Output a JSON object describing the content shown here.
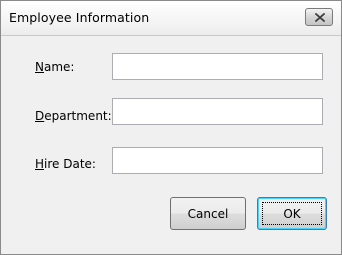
{
  "window": {
    "title": "Employee Information",
    "close_icon": "close-icon"
  },
  "form": {
    "name": {
      "label_mnemonic": "N",
      "label_rest": "ame:",
      "value": ""
    },
    "department": {
      "label_mnemonic": "D",
      "label_rest": "epartment:",
      "value": ""
    },
    "hire_date": {
      "label_mnemonic": "H",
      "label_rest": "ire Date:",
      "value": ""
    }
  },
  "buttons": {
    "cancel_label": "Cancel",
    "ok_label": "OK"
  },
  "colors": {
    "window_background": "#f0f0f0",
    "ok_button_border": "#3c7fb1"
  }
}
